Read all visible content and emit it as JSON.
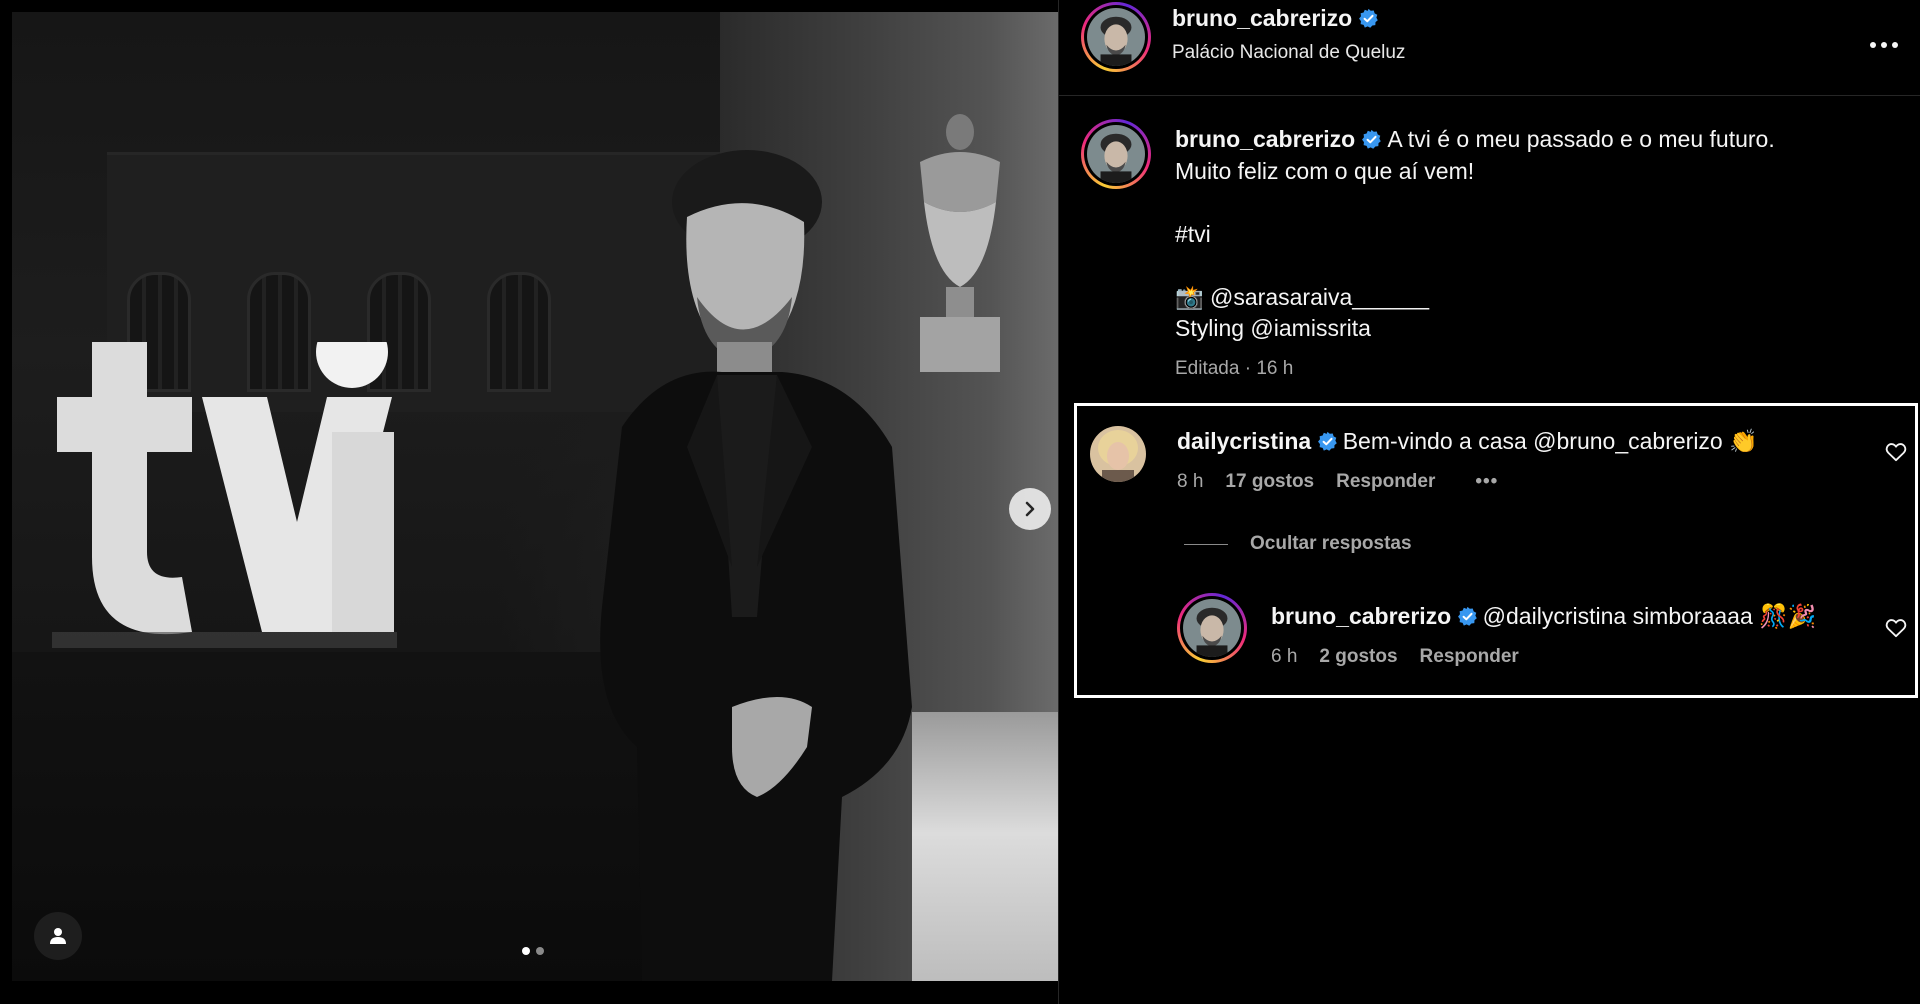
{
  "post": {
    "username": "bruno_cabrerizo",
    "location": "Palácio Nacional de Queluz",
    "more_icon": "more-horizontal-icon",
    "photo": {
      "sign_text": "tvi",
      "carousel_total": 2,
      "carousel_current": 1
    }
  },
  "caption": {
    "username": "bruno_cabrerizo",
    "line1": "A tvi é o meu passado e o meu futuro.",
    "line2": "Muito feliz com o que aí vem!",
    "hashtag": "#tvi",
    "camera_emoji": "📸",
    "photo_credit": "@sarasaraiva______",
    "styling": "Styling @iamissrita",
    "meta": "Editada · 16 h"
  },
  "comments": [
    {
      "username": "dailycristina",
      "text": "Bem-vindo a casa @bruno_cabrerizo 👏",
      "time": "8 h",
      "likes": "17 gostos",
      "reply": "Responder",
      "more": "•••"
    }
  ],
  "hide_replies": "Ocultar respostas",
  "replies": [
    {
      "username": "bruno_cabrerizo",
      "text": "@dailycristina simboraaaa 🎊🎉",
      "time": "6 h",
      "likes": "2 gostos",
      "reply": "Responder"
    }
  ],
  "colors": {
    "background": "#000000",
    "verified": "#3897f0",
    "secondary_text": "#a8a8a8",
    "highlight_border": "#ffffff"
  }
}
